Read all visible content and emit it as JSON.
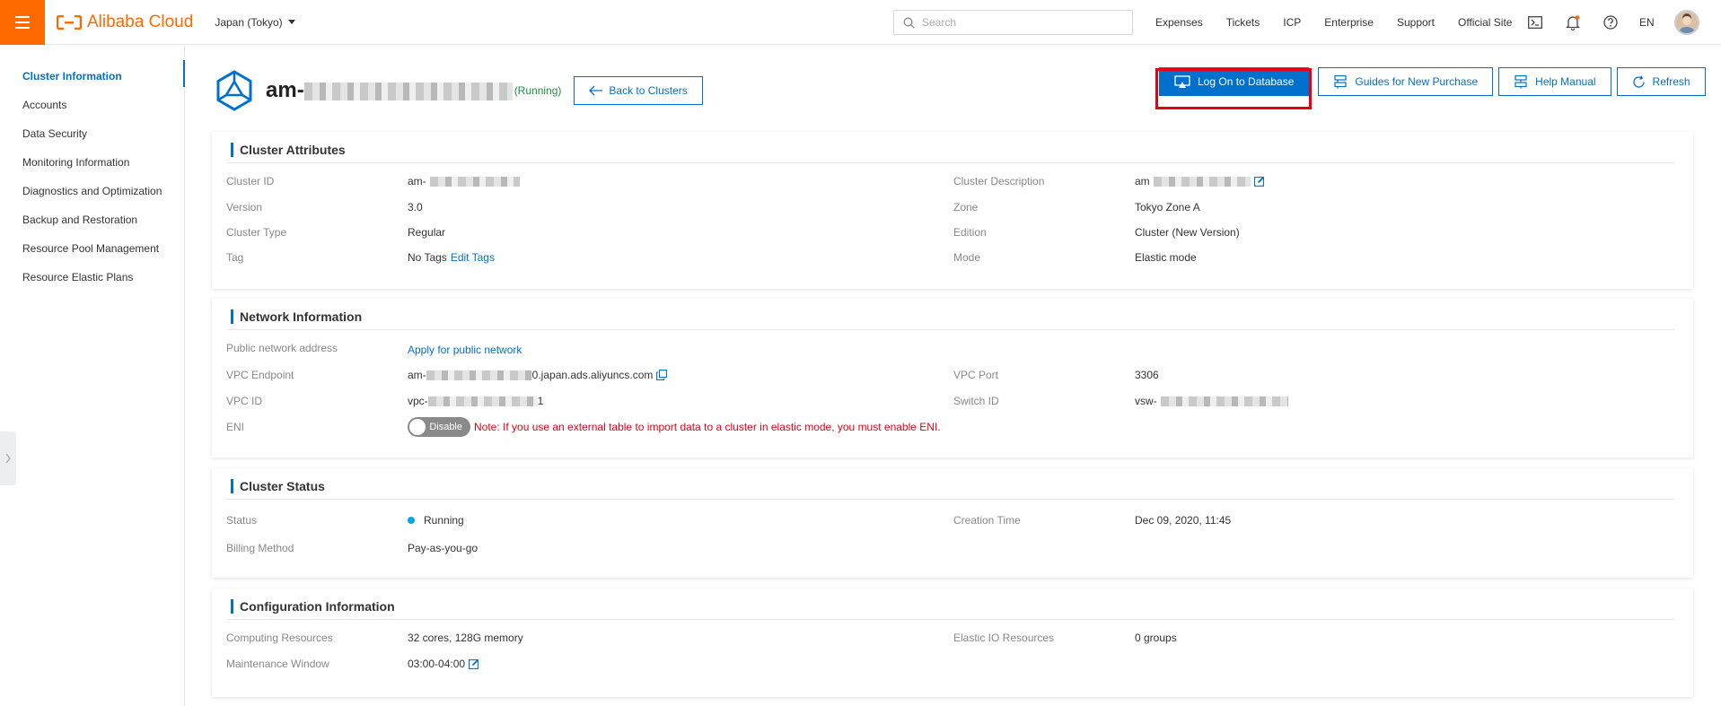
{
  "topbar": {
    "brand": "Alibaba Cloud",
    "region": "Japan (Tokyo)",
    "search_placeholder": "Search",
    "nav": [
      "Expenses",
      "Tickets",
      "ICP",
      "Enterprise",
      "Support",
      "Official Site"
    ],
    "language": "EN",
    "icons": [
      "terminal-icon",
      "bell-icon",
      "help-icon"
    ]
  },
  "sidebar": {
    "items": [
      {
        "label": "Cluster Information",
        "active": true
      },
      {
        "label": "Accounts"
      },
      {
        "label": "Data Security"
      },
      {
        "label": "Monitoring Information"
      },
      {
        "label": "Diagnostics and Optimization"
      },
      {
        "label": "Backup and Restoration"
      },
      {
        "label": "Resource Pool Management"
      },
      {
        "label": "Resource Elastic Plans"
      }
    ]
  },
  "header": {
    "cluster_name_prefix": "am-",
    "status": "(Running)",
    "back_label": "Back to Clusters"
  },
  "actions": {
    "login": "Log On to Database",
    "guides": "Guides for New Purchase",
    "manual": "Help Manual",
    "refresh": "Refresh"
  },
  "attributes": {
    "title": "Cluster Attributes",
    "cluster_id_label": "Cluster ID",
    "cluster_id": "am-",
    "version_label": "Version",
    "version": "3.0",
    "type_label": "Cluster Type",
    "type": "Regular",
    "tag_label": "Tag",
    "tag": "No Tags",
    "edit_tags": "Edit Tags",
    "desc_label": "Cluster Description",
    "desc": "am",
    "zone_label": "Zone",
    "zone": "Tokyo Zone A",
    "edition_label": "Edition",
    "edition": "Cluster (New Version)",
    "mode_label": "Mode",
    "mode": "Elastic mode"
  },
  "network": {
    "title": "Network Information",
    "public_label": "Public network address",
    "public_link": "Apply for public network",
    "vpc_endpoint_label": "VPC Endpoint",
    "vpc_endpoint_prefix": "am-",
    "vpc_endpoint_suffix": "0.japan.ads.aliyuncs.com",
    "vpc_id_label": "VPC ID",
    "vpc_id_prefix": "vpc-",
    "vpc_id_suffix": "1",
    "eni_label": "ENI",
    "eni_toggle": "Disable",
    "eni_note": "Note: If you use an external table to import data to a cluster in elastic mode, you must enable ENI.",
    "vpc_port_label": "VPC Port",
    "vpc_port": "3306",
    "switch_label": "Switch ID",
    "switch_prefix": "vsw-"
  },
  "status": {
    "title": "Cluster Status",
    "status_label": "Status",
    "status": "Running",
    "billing_label": "Billing Method",
    "billing": "Pay-as-you-go",
    "created_label": "Creation Time",
    "created": "Dec 09, 2020, 11:45"
  },
  "config": {
    "title": "Configuration Information",
    "compute_label": "Computing Resources",
    "compute": "32 cores, 128G memory",
    "maint_label": "Maintenance Window",
    "maint": "03:00-04:00",
    "elastic_io_label": "Elastic IO Resources",
    "elastic_io": "0 groups"
  },
  "colors": {
    "accent": "#0070cc",
    "brand": "#ff6a00",
    "highlight": "#e60012",
    "running": "#1e8e3e"
  }
}
